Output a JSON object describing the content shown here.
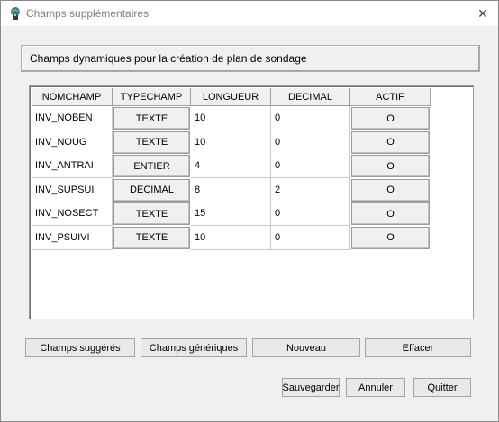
{
  "window": {
    "title": "Champs supplémentaires",
    "close_glyph": "✕"
  },
  "header": {
    "text": "Champs dynamiques pour la création de plan de sondage"
  },
  "table": {
    "columns": [
      "NOMCHAMP",
      "TYPECHAMP",
      "LONGUEUR",
      "DECIMAL",
      "ACTIF"
    ],
    "rows": [
      {
        "nom": "INV_NOBEN",
        "type": "TEXTE",
        "longueur": "10",
        "decimal": "0",
        "actif": "O"
      },
      {
        "nom": "INV_NOUG",
        "type": "TEXTE",
        "longueur": "10",
        "decimal": "0",
        "actif": "O"
      },
      {
        "nom": "INV_ANTRAI",
        "type": "ENTIER",
        "longueur": "4",
        "decimal": "0",
        "actif": "O"
      },
      {
        "nom": "INV_SUPSUI",
        "type": "DECIMAL",
        "longueur": "8",
        "decimal": "2",
        "actif": "O"
      },
      {
        "nom": "INV_NOSECT",
        "type": "TEXTE",
        "longueur": "15",
        "decimal": "0",
        "actif": "O"
      },
      {
        "nom": "INV_PSUIVI",
        "type": "TEXTE",
        "longueur": "10",
        "decimal": "0",
        "actif": "O"
      }
    ]
  },
  "actions": {
    "suggested": "Champs suggérés",
    "generic": "Champs génériques",
    "new": "Nouveau",
    "delete": "Effacer"
  },
  "footer": {
    "save": "Sauvegarder",
    "cancel": "Annuler",
    "quit": "Quitter"
  },
  "colors": {
    "accent": "#0078d7",
    "button_face": "#f0f0f0"
  }
}
